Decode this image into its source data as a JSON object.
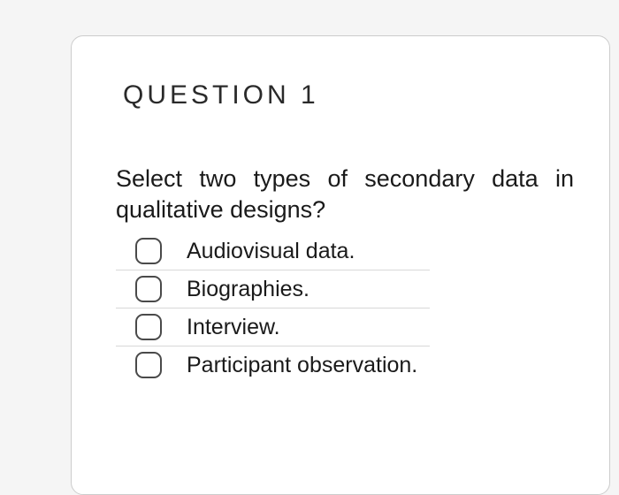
{
  "question": {
    "title": "QUESTION 1",
    "prompt": "Select two types of secondary data in qualitative designs?",
    "options": [
      {
        "label": "Audiovisual data."
      },
      {
        "label": "Biographies."
      },
      {
        "label": "Interview."
      },
      {
        "label": "Participant observation."
      }
    ]
  }
}
